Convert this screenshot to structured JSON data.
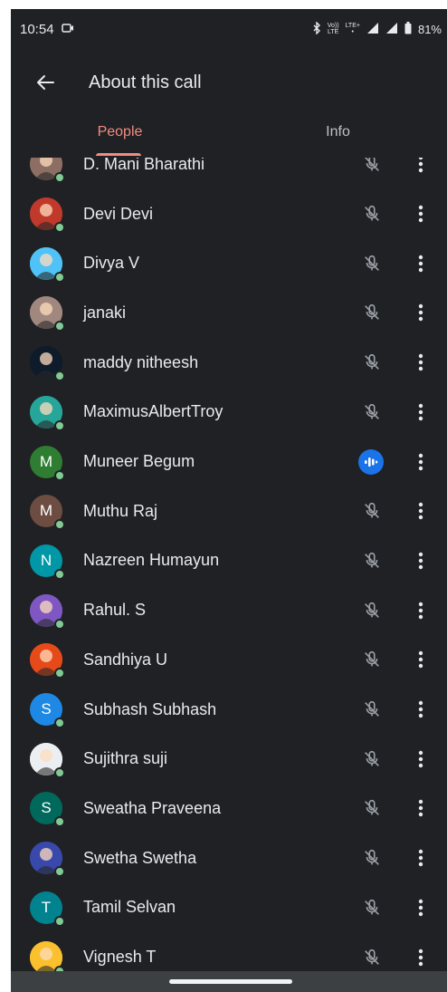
{
  "status_bar": {
    "time": "10:54",
    "volte_top": "Vo))",
    "volte_bottom": "LTE",
    "lte": "LTE+",
    "battery": "81%"
  },
  "app_bar": {
    "title": "About this call"
  },
  "tabs": [
    {
      "label": "People",
      "active": true
    },
    {
      "label": "Info",
      "active": false
    }
  ],
  "participants": [
    {
      "name": "D. Mani Bharathi",
      "avatar": "photo",
      "color": "#8d6e63",
      "mic": "muted"
    },
    {
      "name": "Devi Devi",
      "avatar": "photo",
      "color": "#c0392b",
      "mic": "muted"
    },
    {
      "name": "Divya V",
      "avatar": "photo",
      "color": "#4fc3f7",
      "mic": "muted"
    },
    {
      "name": "janaki",
      "avatar": "photo",
      "color": "#a1887f",
      "mic": "muted"
    },
    {
      "name": "maddy nitheesh",
      "avatar": "photo",
      "color": "#0d1b2a",
      "mic": "muted"
    },
    {
      "name": "MaximusAlbertTroy",
      "avatar": "photo",
      "color": "#26a69a",
      "mic": "muted"
    },
    {
      "name": "Muneer Begum",
      "avatar": "letter",
      "initial": "M",
      "color": "#2e7d32",
      "mic": "speaking"
    },
    {
      "name": "Muthu Raj",
      "avatar": "letter",
      "initial": "M",
      "color": "#6d4c41",
      "mic": "muted"
    },
    {
      "name": "Nazreen Humayun",
      "avatar": "letter",
      "initial": "N",
      "color": "#0097a7",
      "mic": "muted"
    },
    {
      "name": "Rahul. S",
      "avatar": "photo",
      "color": "#7e57c2",
      "mic": "muted"
    },
    {
      "name": "Sandhiya U",
      "avatar": "photo",
      "color": "#e64a19",
      "mic": "muted"
    },
    {
      "name": "Subhash Subhash",
      "avatar": "letter",
      "initial": "S",
      "color": "#1e88e5",
      "mic": "muted"
    },
    {
      "name": "Sujithra suji",
      "avatar": "photo",
      "color": "#eceff1",
      "mic": "muted"
    },
    {
      "name": "Sweatha Praveena",
      "avatar": "letter",
      "initial": "S",
      "color": "#00695c",
      "mic": "muted"
    },
    {
      "name": "Swetha Swetha",
      "avatar": "photo",
      "color": "#3949ab",
      "mic": "muted"
    },
    {
      "name": "Tamil Selvan",
      "avatar": "letter",
      "initial": "T",
      "color": "#00838f",
      "mic": "muted"
    },
    {
      "name": "Vignesh T",
      "avatar": "photo",
      "color": "#fbc02d",
      "mic": "muted"
    }
  ],
  "colors": {
    "background": "#202124",
    "accent": "#f28b82",
    "presence": "#81c995",
    "speaking": "#1a73e8"
  }
}
